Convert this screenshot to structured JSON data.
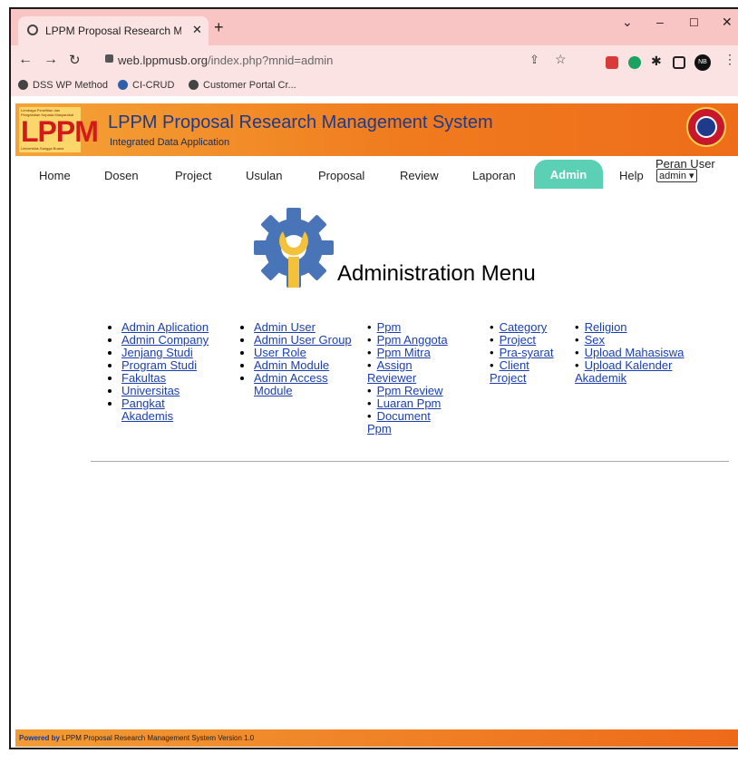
{
  "browser": {
    "tab_title": "LPPM Proposal Research Manage",
    "new_tab": "+",
    "close": "✕",
    "url_host": "web.lppmusb.org",
    "url_path": "/index.php?mnid=admin",
    "bookmarks": [
      "DSS WP Method",
      "CI-CRUD",
      "Customer Portal Cr..."
    ],
    "profile_initials": "NB"
  },
  "header": {
    "logo_text": "LPPM",
    "title": "LPPM Proposal Research Management System",
    "subtitle": "Integrated Data Application"
  },
  "menu": {
    "items": [
      "Home",
      "Dosen",
      "Project",
      "Usulan",
      "Proposal",
      "Review",
      "Laporan",
      "Admin",
      "Help"
    ],
    "active": "Admin",
    "role_label": "Peran User",
    "role_value": "admin ▾"
  },
  "page": {
    "title": "Administration Menu",
    "columns": [
      [
        "Admin Aplication",
        "Admin Company",
        "Jenjang Studi",
        "Program Studi",
        "Fakultas",
        "Universitas",
        "Pangkat Akademis"
      ],
      [
        "Admin User",
        "Admin User Group",
        "User Role",
        "Admin Module",
        "Admin Access Module"
      ],
      [
        "Ppm",
        "Ppm Anggota",
        "Ppm Mitra",
        "Assign Reviewer",
        "Ppm Review",
        "Luaran Ppm",
        "Document Ppm"
      ],
      [
        "Category",
        "Project",
        "Pra-syarat",
        "Client Project"
      ],
      [
        "Religion",
        "Sex",
        "Upload Mahasiswa",
        "Upload Kalender Akademik"
      ]
    ]
  },
  "footer": {
    "powered": "Powered by",
    "text": "LPPM Proposal Research Management System Version 1.0"
  }
}
